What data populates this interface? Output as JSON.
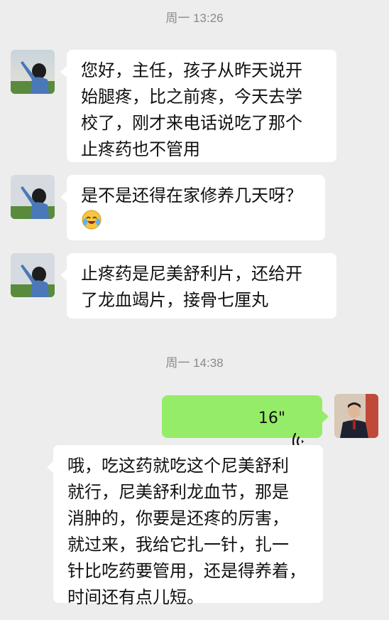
{
  "timestamps": {
    "first": "周一 13:26",
    "second": "周一 14:38"
  },
  "messages": [
    {
      "sender": "other",
      "text": "您好，主任，孩子从昨天说开\n始腿疼，比之前疼，今天去学\n校了，刚才来电话说吃了那个\n止疼药也不管用"
    },
    {
      "sender": "other",
      "text": "是不是还得在家修养几天呀？",
      "emoji": "crying-laughing-emoji"
    },
    {
      "sender": "other",
      "text": "止疼药是尼美舒利片，还给开\n了龙血竭片，接骨七厘丸"
    },
    {
      "sender": "self",
      "type": "voice",
      "duration": "16\"",
      "icon": "voice-wave-icon"
    },
    {
      "sender": "other",
      "text": "哦，吃这药就吃这个尼美舒利\n就行，尼美舒利龙血节，那是\n消肿的，你要是还疼的厉害，\n就过来，我给它扎一针，扎一\n针比吃药要管用，还是得养着，\n时间还有点儿短。"
    }
  ],
  "colors": {
    "background": "#ededed",
    "incoming_bubble": "#ffffff",
    "outgoing_bubble": "#95ec69",
    "timestamp": "#8a8a8a"
  }
}
